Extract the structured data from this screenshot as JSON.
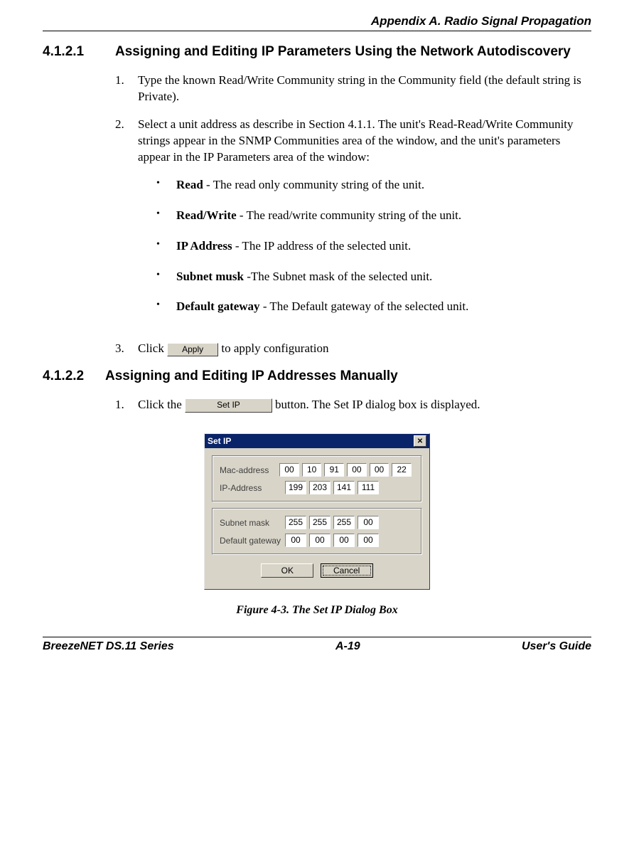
{
  "header": {
    "appendix": "Appendix A. Radio Signal Propagation"
  },
  "section1": {
    "number": "4.1.2.1",
    "title": "Assigning and Editing IP Parameters Using the Network Autodiscovery",
    "steps": {
      "s1_num": "1.",
      "s1_text": "Type the known Read/Write Community string in the Community field (the default string is Private).",
      "s2_num": "2.",
      "s2_text": "Select a unit address as describe in Section 4.1.1. The unit's Read-Read/Write Community strings appear in the SNMP Communities area of the window, and the unit's parameters appear in the IP Parameters area of the window:",
      "bullets": {
        "b1_term": "Read",
        "b1_text": " - The read only community string of the unit.",
        "b2_term": "Read/Write",
        "b2_text": " - The read/write community string of the unit.",
        "b3_term": "IP Address",
        "b3_text": " - The IP address of the selected unit.",
        "b4_term": "Subnet musk",
        "b4_text": " -The Subnet mask of the selected unit.",
        "b5_term": "Default gateway",
        "b5_text": " - The Default gateway of the selected unit."
      },
      "s3_num": "3.",
      "s3_pre": "Click ",
      "s3_btn": "Apply",
      "s3_post": " to apply configuration"
    }
  },
  "section2": {
    "number": "4.1.2.2",
    "title": "Assigning and Editing IP Addresses Manually",
    "steps": {
      "s1_num": "1.",
      "s1_pre": "Click the ",
      "s1_btn": "Set IP",
      "s1_post": " button. The Set IP dialog box is displayed."
    }
  },
  "dialog": {
    "title": "Set IP",
    "close_glyph": "✕",
    "mac_label": "Mac-address",
    "mac": [
      "00",
      "10",
      "91",
      "00",
      "00",
      "22"
    ],
    "ip_label": "IP-Address",
    "ip": [
      "199",
      "203",
      "141",
      "111"
    ],
    "subnet_label": "Subnet mask",
    "subnet": [
      "255",
      "255",
      "255",
      "00"
    ],
    "gateway_label": "Default gateway",
    "gateway": [
      "00",
      "00",
      "00",
      "00"
    ],
    "ok": "OK",
    "cancel": "Cancel"
  },
  "figure_caption": "Figure 4-3.  The Set IP Dialog Box",
  "footer": {
    "left": "BreezeNET DS.11 Series",
    "center": "A-19",
    "right": "User's Guide"
  }
}
